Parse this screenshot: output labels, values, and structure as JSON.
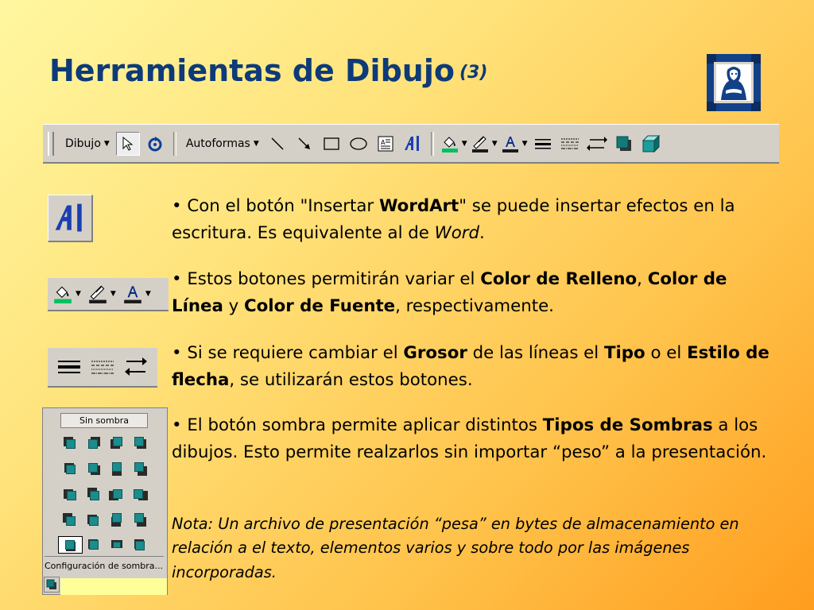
{
  "slide": {
    "title": "Herramientas de Dibujo",
    "title_number": "(3)"
  },
  "toolbar": {
    "dibujo_label": "Dibujo",
    "autoformas_label": "Autoformas",
    "icons": [
      "select-arrow-icon",
      "free-rotate-icon",
      "line-icon",
      "arrow-icon",
      "rectangle-icon",
      "oval-icon",
      "text-box-icon",
      "wordart-icon",
      "fill-color-icon",
      "line-color-icon",
      "font-color-icon",
      "line-style-icon",
      "dash-style-icon",
      "arrow-style-icon",
      "shadow-icon",
      "3d-icon"
    ]
  },
  "shadow_panel": {
    "sin_sombra": "Sin sombra",
    "config_label": "Configuración de sombra..."
  },
  "bullets": [
    {
      "prefix": "• Con el botón \"Insertar ",
      "bold1": "WordArt",
      "mid": "\" se puede insertar efectos en la escritura. Es equivalente al de ",
      "italic1": "Word",
      "end": "."
    },
    {
      "prefix": "• Estos botones permitirán variar el ",
      "bold1": "Color de Relleno",
      "sep1": ", ",
      "bold2": "Color de Línea",
      "sep2": " y ",
      "bold3": "Color de Fuente",
      "end": ", respectivamente."
    },
    {
      "prefix": "• Si se requiere cambiar el ",
      "bold1": "Grosor",
      "mid1": " de las líneas el ",
      "bold2": "Tipo",
      "mid2": " o el ",
      "bold3": "Estilo de flecha",
      "end": ", se utilizarán estos botones."
    },
    {
      "prefix": "• El botón sombra permite aplicar distintos ",
      "bold1": "Tipos de Sombras",
      "end": " a los dibujos. Esto permite realzarlos sin importar “peso” a la presentación."
    }
  ],
  "note": "Nota: Un archivo de presentación “pesa” en bytes de almacenamiento en relación a el texto, elementos varios y sobre todo por las imágenes incorporadas.",
  "colors": {
    "title": "#0d3a78",
    "fill_swatch": "#00c060",
    "line_swatch": "#1a1a1a",
    "font_swatch": "#1a1a1a",
    "frame": "#12418a"
  }
}
